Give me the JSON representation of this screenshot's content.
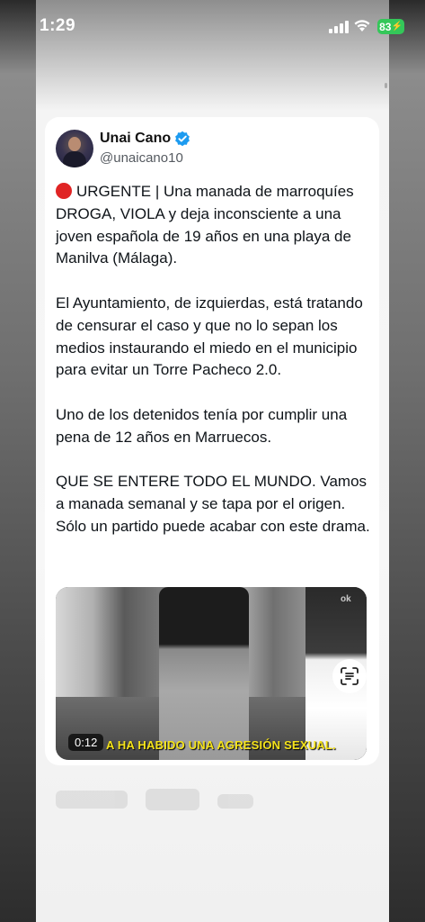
{
  "status_bar": {
    "time": "1:29",
    "battery": "83"
  },
  "tweet": {
    "author_name": "Unai Cano",
    "handle": "@unaicano10",
    "paragraphs": [
      "URGENTE | Una manada de marroquíes DROGA, VIOLA y deja inconsciente a una joven española de 19 años en una playa de Manilva (Málaga).",
      "El Ayuntamiento, de izquierdas, está tratando de censurar el caso y que no lo sepan los medios instaurando el miedo en el municipio para evitar un Torre Pacheco 2.0.",
      "Uno de los detenidos tenía por cumplir una pena de 12 años en Marruecos.",
      "QUE SE ENTERE TODO EL MUNDO. Vamos a manada semanal y se tapa por el origen. Sólo un partido puede acabar con este drama."
    ]
  },
  "video": {
    "timestamp": "0:12",
    "subtitle": "A HA HABIDO UNA AGRESIÓN SEXUAL.",
    "corner_mark": "ok"
  },
  "icons": {
    "verified": "verified-badge-icon",
    "red_dot": "red-circle-icon",
    "lens": "visual-search-icon",
    "signal": "cellular-signal-icon",
    "wifi": "wifi-icon",
    "battery": "battery-charging-icon"
  },
  "colors": {
    "battery": "#34c759",
    "verified": "#1d9bf0",
    "red_dot": "#e02424",
    "subtitle": "#f5e31a"
  }
}
